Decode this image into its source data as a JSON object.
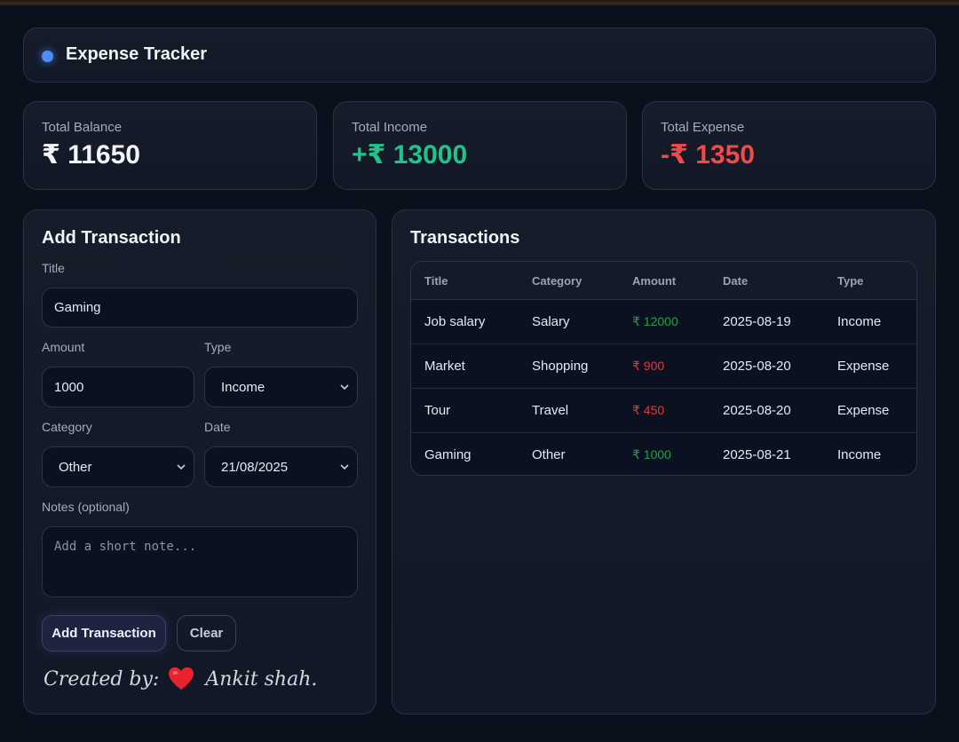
{
  "app": {
    "title": "Expense Tracker",
    "accent": "#4c8dff"
  },
  "stats": [
    {
      "label": "Total Balance",
      "value": "₹ 11650",
      "color": "#f3f5f9"
    },
    {
      "label": "Total Income",
      "value": "+₹ 13000",
      "color": "#22c38b"
    },
    {
      "label": "Total Expense",
      "value": "-₹ 1350",
      "color": "#ef4b4b"
    }
  ],
  "form": {
    "title": "Add Transaction",
    "title_label": "Title",
    "title_value": "Gaming",
    "amount_label": "Amount",
    "amount_value": "1000",
    "type_label": "Type",
    "type_value": "Income",
    "category_label": "Category",
    "category_value": "Other",
    "date_label": "Date",
    "date_value": "21/08/2025",
    "notes_label": "Notes (optional)",
    "notes_placeholder": "Add a short note...",
    "add_button": "Add Transaction",
    "clear_button": "Clear",
    "credit_prefix": "Created by:",
    "credit_name": "Ankit shah."
  },
  "transactions": {
    "title": "Transactions",
    "columns": [
      "Title",
      "Category",
      "Amount",
      "Date",
      "Type"
    ],
    "rows": [
      {
        "title": "Job salary",
        "category": "Salary",
        "amount": "₹ 12000",
        "date": "2025-08-19",
        "type": "Income"
      },
      {
        "title": "Market",
        "category": "Shopping",
        "amount": "₹ 900",
        "date": "2025-08-20",
        "type": "Expense"
      },
      {
        "title": "Tour",
        "category": "Travel",
        "amount": "₹ 450",
        "date": "2025-08-20",
        "type": "Expense"
      },
      {
        "title": "Gaming",
        "category": "Other",
        "amount": "₹ 1000",
        "date": "2025-08-21",
        "type": "Income"
      }
    ],
    "income_color": "#1fa34a",
    "expense_color": "#e23a3a"
  }
}
